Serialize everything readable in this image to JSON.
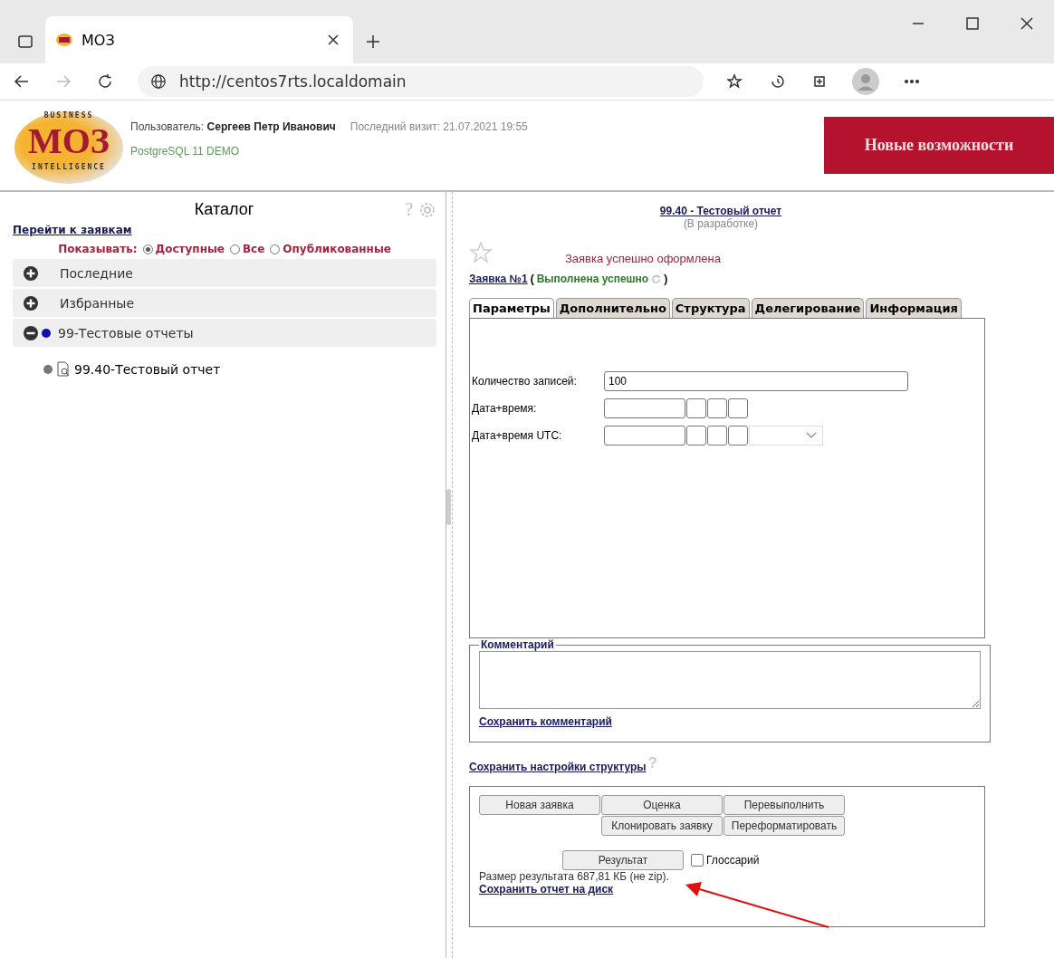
{
  "browser": {
    "tab_title": "МОЗ",
    "url": "http://centos7rts.localdomain"
  },
  "header": {
    "logo": {
      "top": "BUSINESS",
      "main": "МОЗ",
      "bottom": "INTELLIGENCE"
    },
    "user_label": "Пользователь:",
    "user_name": "Сергеев Петр Иванович",
    "last_visit": "Последний визит: 21.07.2021 19:55",
    "database": "PostgreSQL 11 DEMO",
    "promo_button": "Новые возможности"
  },
  "catalog": {
    "title": "Каталог",
    "help": "?",
    "requests_link": "Перейти к заявкам",
    "show_label": "Показывать:",
    "show_options": [
      {
        "label": "Доступные",
        "selected": true
      },
      {
        "label": "Все",
        "selected": false
      },
      {
        "label": "Опубликованные",
        "selected": false
      }
    ],
    "groups": [
      {
        "label": "Последние",
        "expanded": false
      },
      {
        "label": "Избранные",
        "expanded": false
      },
      {
        "label": "99-Тестовые отчеты",
        "expanded": true,
        "children": [
          {
            "label": "99.40-Тестовый отчет"
          }
        ]
      }
    ]
  },
  "report": {
    "title": "99.40 - Тестовый отчет",
    "status": "(В разработке)",
    "favorite": false,
    "message": "Заявка успешно оформлена",
    "request_link": "Заявка №1",
    "paren_open": "(",
    "request_status": "Выполнена успешно",
    "paren_close": ")",
    "tabs": [
      {
        "label": "Параметры",
        "selected": true
      },
      {
        "label": "Дополнительно",
        "selected": false
      },
      {
        "label": "Структура",
        "selected": false
      },
      {
        "label": "Делегирование",
        "selected": false
      },
      {
        "label": "Информация",
        "selected": false
      }
    ],
    "params": [
      {
        "kind": "text",
        "label": "Количество записей:",
        "value": "100"
      },
      {
        "kind": "datetime",
        "label": "Дата+время:"
      },
      {
        "kind": "datetime_tz",
        "label": "Дата+время UTC:"
      }
    ],
    "comment": {
      "legend": "Комментарий",
      "save_link": "Сохранить комментарий"
    },
    "save_structure_link": "Сохранить настройки структуры",
    "structure_help": "?",
    "actions": {
      "row1": [
        "Новая заявка",
        "Оценка",
        "Перевыполнить"
      ],
      "row2": [
        "Клонировать заявку",
        "Переформатировать"
      ],
      "result_button": "Результат",
      "glossary": {
        "label": "Глоссарий",
        "checked": false
      },
      "size_text": "Размер результата 687,81 КБ (не zip).",
      "save_disk_link": "Сохранить отчет на диск"
    }
  }
}
